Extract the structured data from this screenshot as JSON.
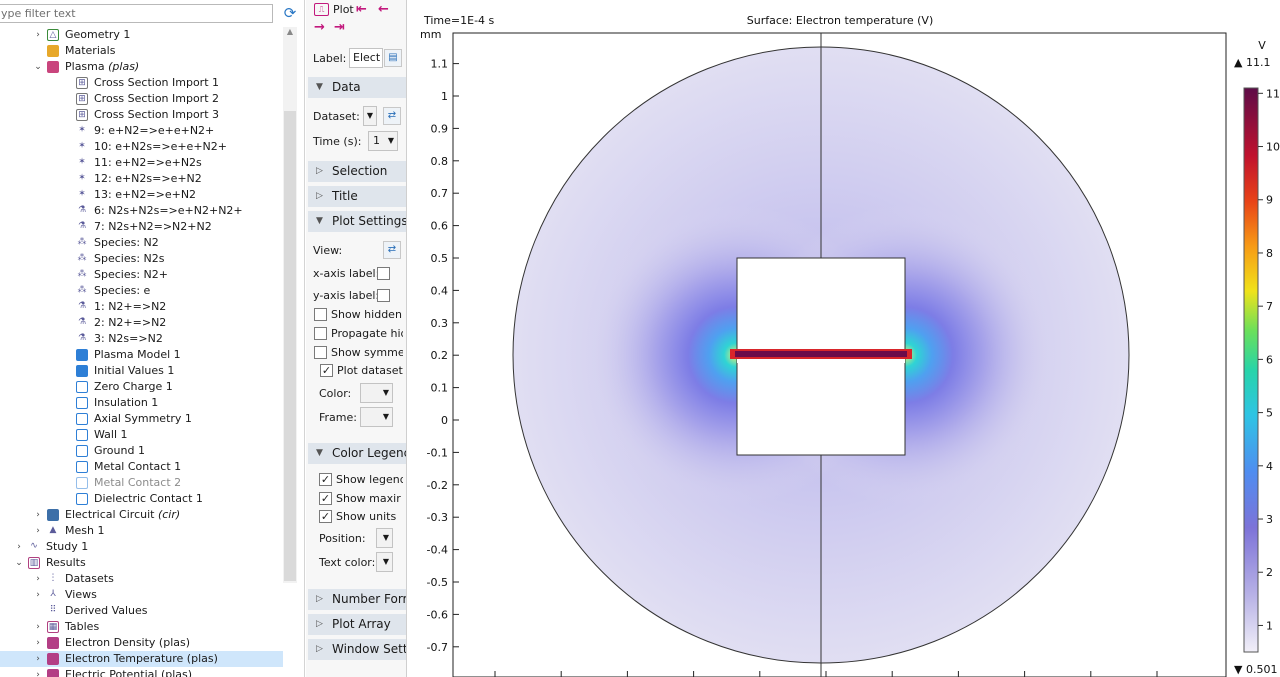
{
  "tree": {
    "filter_placeholder": "ype filter text",
    "items": [
      {
        "label": "Geometry 1",
        "indent": 2,
        "caret": "›",
        "icon": "geometry-icon"
      },
      {
        "label": "Materials",
        "indent": 2,
        "caret": "",
        "icon": "materials-icon"
      },
      {
        "label": "Plasma",
        "suffix": "(plas)",
        "indent": 2,
        "caret": "⌄",
        "icon": "plasma-icon"
      },
      {
        "label": "Cross Section Import 1",
        "indent": 3,
        "caret": "",
        "icon": "cross-section-icon"
      },
      {
        "label": "Cross Section Import 2",
        "indent": 3,
        "caret": "",
        "icon": "cross-section-icon"
      },
      {
        "label": "Cross Section Import 3",
        "indent": 3,
        "caret": "",
        "icon": "cross-section-icon"
      },
      {
        "label": "9: e+N2=>e+e+N2+",
        "indent": 3,
        "caret": "",
        "icon": "reaction-icon"
      },
      {
        "label": "10: e+N2s=>e+e+N2+",
        "indent": 3,
        "caret": "",
        "icon": "reaction-icon"
      },
      {
        "label": "11: e+N2=>e+N2s",
        "indent": 3,
        "caret": "",
        "icon": "reaction-icon"
      },
      {
        "label": "12: e+N2s=>e+N2",
        "indent": 3,
        "caret": "",
        "icon": "reaction-icon"
      },
      {
        "label": "13: e+N2=>e+N2",
        "indent": 3,
        "caret": "",
        "icon": "reaction-icon"
      },
      {
        "label": "6: N2s+N2s=>e+N2+N2+",
        "indent": 3,
        "caret": "",
        "icon": "flask-icon"
      },
      {
        "label": "7: N2s+N2=>N2+N2",
        "indent": 3,
        "caret": "",
        "icon": "flask-icon"
      },
      {
        "label": "Species: N2",
        "indent": 3,
        "caret": "",
        "icon": "species-icon"
      },
      {
        "label": "Species: N2s",
        "indent": 3,
        "caret": "",
        "icon": "species-icon"
      },
      {
        "label": "Species: N2+",
        "indent": 3,
        "caret": "",
        "icon": "species-icon"
      },
      {
        "label": "Species: e",
        "indent": 3,
        "caret": "",
        "icon": "species-icon"
      },
      {
        "label": "1: N2+=>N2",
        "indent": 3,
        "caret": "",
        "icon": "flask-icon"
      },
      {
        "label": "2: N2+=>N2",
        "indent": 3,
        "caret": "",
        "icon": "flask-icon"
      },
      {
        "label": "3: N2s=>N2",
        "indent": 3,
        "caret": "",
        "icon": "flask-icon"
      },
      {
        "label": "Plasma Model 1",
        "indent": 3,
        "caret": "",
        "icon": "domain-feature-icon"
      },
      {
        "label": "Initial Values 1",
        "indent": 3,
        "caret": "",
        "icon": "domain-feature-icon"
      },
      {
        "label": "Zero Charge 1",
        "indent": 3,
        "caret": "",
        "icon": "boundary-feature-icon"
      },
      {
        "label": "Insulation 1",
        "indent": 3,
        "caret": "",
        "icon": "boundary-feature-icon"
      },
      {
        "label": "Axial Symmetry 1",
        "indent": 3,
        "caret": "",
        "icon": "boundary-feature-icon"
      },
      {
        "label": "Wall 1",
        "indent": 3,
        "caret": "",
        "icon": "boundary-feature-icon"
      },
      {
        "label": "Ground 1",
        "indent": 3,
        "caret": "",
        "icon": "boundary-feature-icon"
      },
      {
        "label": "Metal Contact 1",
        "indent": 3,
        "caret": "",
        "icon": "boundary-feature-icon"
      },
      {
        "label": "Metal Contact 2",
        "indent": 3,
        "caret": "",
        "icon": "boundary-feature-icon",
        "disabled": true
      },
      {
        "label": "Dielectric Contact 1",
        "indent": 3,
        "caret": "",
        "icon": "boundary-feature-icon"
      },
      {
        "label": "Electrical Circuit",
        "suffix": "(cir)",
        "indent": 2,
        "caret": "›",
        "icon": "circuit-icon"
      },
      {
        "label": "Mesh 1",
        "indent": 2,
        "caret": "›",
        "icon": "mesh-icon"
      },
      {
        "label": "Study 1",
        "indent": 1,
        "caret": "›",
        "icon": "study-icon"
      },
      {
        "label": "Results",
        "indent": 1,
        "caret": "⌄",
        "icon": "results-icon"
      },
      {
        "label": "Datasets",
        "indent": 2,
        "caret": "›",
        "icon": "datasets-icon"
      },
      {
        "label": "Views",
        "indent": 2,
        "caret": "›",
        "icon": "views-icon"
      },
      {
        "label": "Derived Values",
        "indent": 2,
        "caret": "",
        "icon": "derived-values-icon"
      },
      {
        "label": "Tables",
        "indent": 2,
        "caret": "›",
        "icon": "tables-icon"
      },
      {
        "label": "Electron Density (plas)",
        "indent": 2,
        "caret": "›",
        "icon": "plot-group-icon"
      },
      {
        "label": "Electron Temperature (plas)",
        "indent": 2,
        "caret": "›",
        "icon": "plot-group-icon",
        "selected": true
      },
      {
        "label": "Electric Potential (plas)",
        "indent": 2,
        "caret": "›",
        "icon": "plot-group-icon"
      }
    ]
  },
  "settings": {
    "plot_label": "Plot",
    "label_label": "Label:",
    "label_value": "Elect",
    "sections": {
      "data": "Data",
      "selection": "Selection",
      "title": "Title",
      "plot_settings": "Plot Settings",
      "color_legend": "Color Legenc",
      "number_format": "Number Forr",
      "plot_array": "Plot Array",
      "window_settings": "Window Setti"
    },
    "dataset_label": "Dataset:",
    "time_label": "Time (s):",
    "time_value": "1",
    "view_label": "View:",
    "xaxis_label": "x-axis label:",
    "yaxis_label": "y-axis label:",
    "show_hidden": "Show hidden e",
    "propagate_hiding": "Propagate hidi",
    "show_symmetry": "Show symmetı",
    "plot_dataset_edges": "Plot dataset e",
    "color_label": "Color:",
    "frame_label": "Frame:",
    "show_legends": "Show legends",
    "show_maxmin": "Show maxir",
    "show_units": "Show units",
    "position_label": "Position:",
    "text_color_label": "Text color:"
  },
  "plot": {
    "time_text": "Time=1E-4 s",
    "title": "Surface: Electron temperature (V)",
    "y_unit": "mm",
    "y_ticks": [
      "1.1",
      "1",
      "0.9",
      "0.8",
      "0.7",
      "0.6",
      "0.5",
      "0.4",
      "0.3",
      "0.2",
      "0.1",
      "0",
      "-0.1",
      "-0.2",
      "-0.3",
      "-0.4",
      "-0.5",
      "-0.6",
      "-0.7"
    ],
    "y_tick_values": [
      1.1,
      1,
      0.9,
      0.8,
      0.7,
      0.6,
      0.5,
      0.4,
      0.3,
      0.2,
      0.1,
      0,
      -0.1,
      -0.2,
      -0.3,
      -0.4,
      -0.5,
      -0.6,
      -0.7
    ],
    "legend_unit": "V",
    "legend_max": "▲ 11.1",
    "legend_min": "▼ 0.501",
    "legend_ticks": [
      "11",
      "10",
      "9",
      "8",
      "7",
      "6",
      "5",
      "4",
      "3",
      "2",
      "1"
    ],
    "legend_tick_values": [
      11,
      10,
      9,
      8,
      7,
      6,
      5,
      4,
      3,
      2,
      1
    ],
    "colors": {
      "low": "#ddd8ee",
      "mid": "#7a7adc",
      "cyan": "#31c8e6",
      "yellow": "#f0e600",
      "red": "#d21a1a",
      "high": "#5a0a48"
    }
  }
}
